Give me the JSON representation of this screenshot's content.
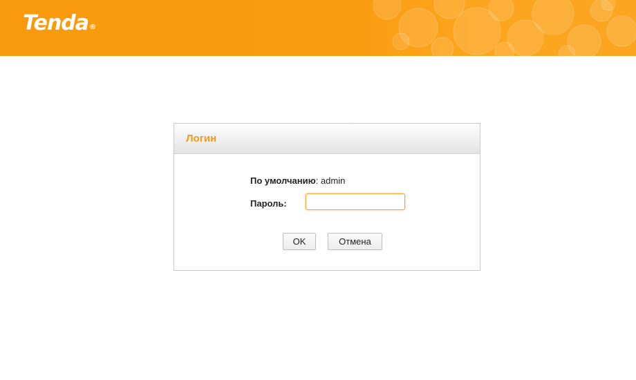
{
  "header": {
    "logo_text": "Tenda",
    "logo_mark": "®",
    "background_color": "#fb9c10"
  },
  "login": {
    "title": "Логин",
    "default_label": "По умолчанию",
    "default_separator": ":",
    "default_value": "admin",
    "password_label": "Пароль:",
    "password_value": "",
    "ok_label": "OK",
    "cancel_label": "Отмена",
    "title_color": "#f39a19"
  }
}
